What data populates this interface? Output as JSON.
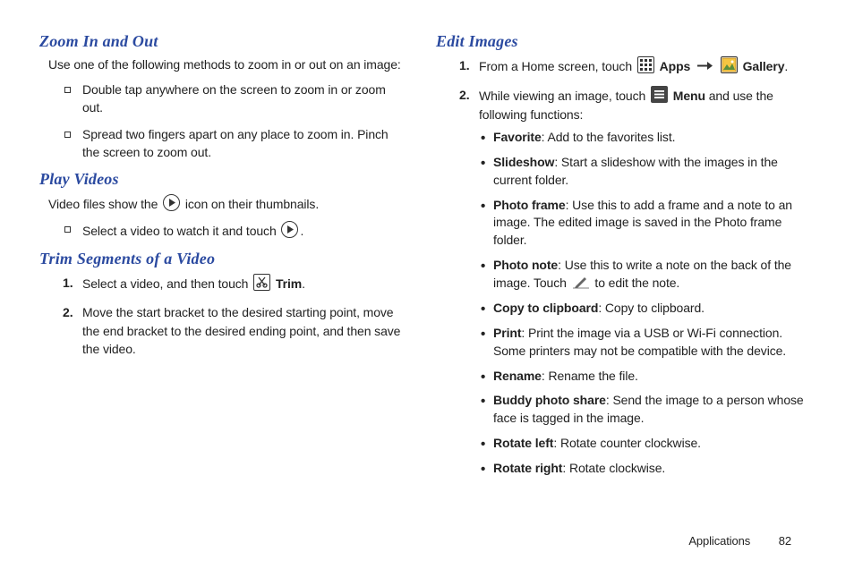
{
  "left": {
    "zoom": {
      "heading": "Zoom In and Out",
      "intro": "Use one of the following methods to zoom in or out on an image:",
      "items": [
        "Double tap anywhere on the screen to zoom in or zoom out.",
        "Spread two fingers apart on any place to zoom in. Pinch the screen to zoom out."
      ]
    },
    "play": {
      "heading": "Play Videos",
      "intro_pre": "Video files show the ",
      "intro_post": " icon on their thumbnails.",
      "item_pre": "Select a video to watch it and touch ",
      "item_post": "."
    },
    "trim": {
      "heading": "Trim Segments of a Video",
      "step1_pre": "Select a video, and then touch ",
      "step1_label": "Trim",
      "step1_post": ".",
      "step2": "Move the start bracket to the desired starting point, move the end bracket to the desired ending point, and then save the video."
    }
  },
  "right": {
    "edit": {
      "heading": "Edit Images",
      "step1_pre": "From a Home screen, touch ",
      "apps_label": "Apps",
      "gallery_label": "Gallery",
      "step1_post": ".",
      "step2_pre": "While viewing an image, touch ",
      "menu_label": "Menu",
      "step2_post": " and use the following functions:",
      "bullets": [
        {
          "label": "Favorite",
          "text": ": Add to the favorites list."
        },
        {
          "label": "Slideshow",
          "text": ": Start a slideshow with the images in the current folder."
        },
        {
          "label": "Photo frame",
          "text": ": Use this to add a frame and a note to an image. The edited image is saved in the Photo frame folder."
        },
        {
          "label": "Photo note",
          "text_pre": ": Use this to write a note on the back of the image. Touch ",
          "text_post": " to edit the note."
        },
        {
          "label": "Copy to clipboard",
          "text": ": Copy to clipboard."
        },
        {
          "label": "Print",
          "text": ": Print the image via a USB or Wi-Fi connection. Some printers may not be compatible with the device."
        },
        {
          "label": "Rename",
          "text": ": Rename the file."
        },
        {
          "label": "Buddy photo share",
          "text": ": Send the image to a person whose face is tagged in the image."
        },
        {
          "label": "Rotate left",
          "text": ": Rotate counter clockwise."
        },
        {
          "label": "Rotate right",
          "text": ": Rotate clockwise."
        }
      ]
    }
  },
  "footer": {
    "section": "Applications",
    "page": "82"
  }
}
